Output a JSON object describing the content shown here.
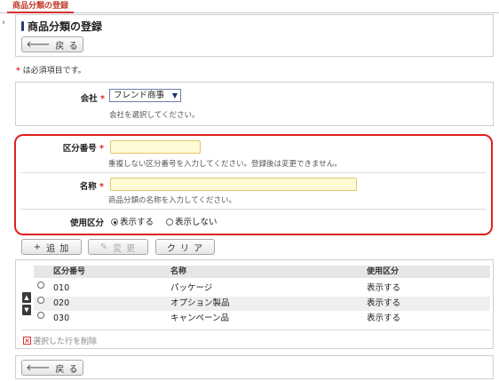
{
  "tab": {
    "label": "商品分類の登録"
  },
  "header": {
    "title": "商品分類の登録",
    "back_label": "戻 る"
  },
  "required_note": {
    "mark": "*",
    "text": " は必須項目です。"
  },
  "company": {
    "label": "会社",
    "required_mark": "*",
    "selected": "フレンド商事",
    "help": "会社を選択してください。"
  },
  "form": {
    "code": {
      "label": "区分番号",
      "required_mark": "*",
      "value": "",
      "help": "重複しない区分番号を入力してください。登録後は変更できません。"
    },
    "name": {
      "label": "名称",
      "required_mark": "*",
      "value": "",
      "help": "商品分類の名称を入力してください。"
    },
    "usage": {
      "label": "使用区分",
      "options": [
        "表示する",
        "表示しない"
      ],
      "selected": "表示する"
    }
  },
  "actions": {
    "add": "追 加",
    "edit": "変 更",
    "clear": "ク リ ア"
  },
  "table": {
    "headers": [
      "区分番号",
      "名称",
      "使用区分"
    ],
    "rows": [
      {
        "code": "010",
        "name": "パッケージ",
        "usage": "表示する"
      },
      {
        "code": "020",
        "name": "オプション製品",
        "usage": "表示する"
      },
      {
        "code": "030",
        "name": "キャンペーン品",
        "usage": "表示する"
      }
    ],
    "delete_label": "選択した行を削除"
  },
  "footer": {
    "back_label": "戻 る"
  }
}
